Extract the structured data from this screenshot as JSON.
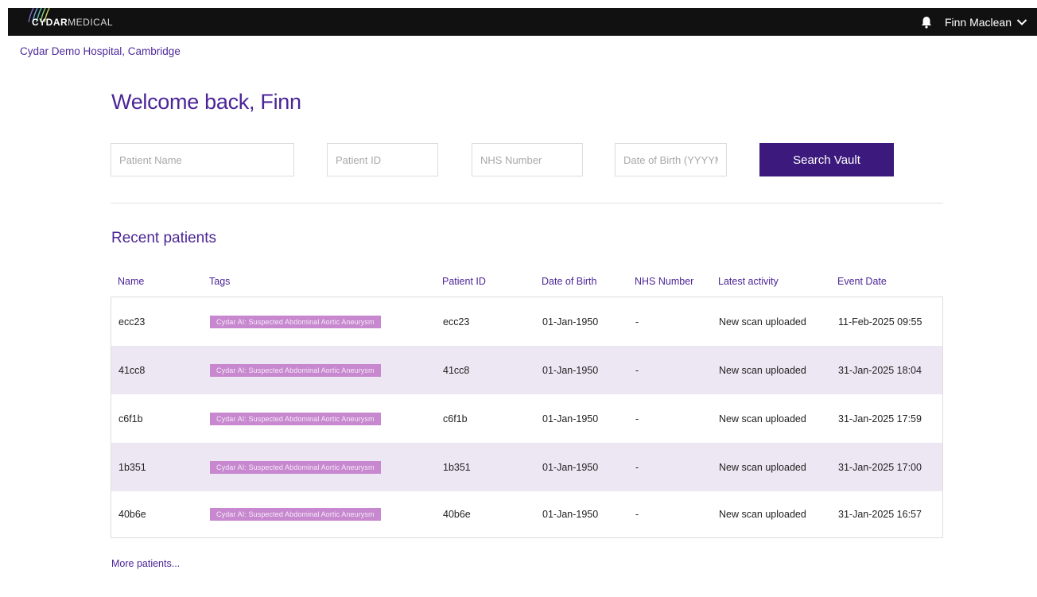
{
  "topbar": {
    "brand_bold": "CYDAR",
    "brand_light": "MEDICAL",
    "user_name": "Finn Maclean"
  },
  "hospital": "Cydar Demo Hospital, Cambridge",
  "welcome": "Welcome back, Finn",
  "search": {
    "name_placeholder": "Patient Name",
    "id_placeholder": "Patient ID",
    "nhs_placeholder": "NHS Number",
    "dob_placeholder": "Date of Birth (YYYYMM",
    "button_label": "Search Vault"
  },
  "recent": {
    "title": "Recent patients",
    "columns": [
      "Name",
      "Tags",
      "Patient ID",
      "Date of Birth",
      "NHS Number",
      "Latest activity",
      "Event Date"
    ],
    "rows": [
      {
        "name": "ecc23",
        "tag": "Cydar AI: Suspected Abdominal Aortic Aneurysm",
        "patient_id": "ecc23",
        "dob": "01-Jan-1950",
        "nhs": "-",
        "activity": "New scan uploaded",
        "event_date": "11-Feb-2025 09:55"
      },
      {
        "name": "41cc8",
        "tag": "Cydar AI: Suspected Abdominal Aortic Aneurysm",
        "patient_id": "41cc8",
        "dob": "01-Jan-1950",
        "nhs": "-",
        "activity": "New scan uploaded",
        "event_date": "31-Jan-2025 18:04"
      },
      {
        "name": "c6f1b",
        "tag": "Cydar AI: Suspected Abdominal Aortic Aneurysm",
        "patient_id": "c6f1b",
        "dob": "01-Jan-1950",
        "nhs": "-",
        "activity": "New scan uploaded",
        "event_date": "31-Jan-2025 17:59"
      },
      {
        "name": "1b351",
        "tag": "Cydar AI: Suspected Abdominal Aortic Aneurysm",
        "patient_id": "1b351",
        "dob": "01-Jan-1950",
        "nhs": "-",
        "activity": "New scan uploaded",
        "event_date": "31-Jan-2025 17:00"
      },
      {
        "name": "40b6e",
        "tag": "Cydar AI: Suspected Abdominal Aortic Aneurysm",
        "patient_id": "40b6e",
        "dob": "01-Jan-1950",
        "nhs": "-",
        "activity": "New scan uploaded",
        "event_date": "31-Jan-2025 16:57"
      }
    ],
    "more_link": "More patients..."
  },
  "colors": {
    "accent": "#4b2597",
    "button": "#3c1a7d",
    "tag_bg": "#c788cf",
    "row_alt": "#ede6f3",
    "topbar": "#111111"
  },
  "icons": {
    "bell": "bell-icon",
    "chevron": "chevron-down-icon",
    "logo": "cydar-logo-mark"
  }
}
